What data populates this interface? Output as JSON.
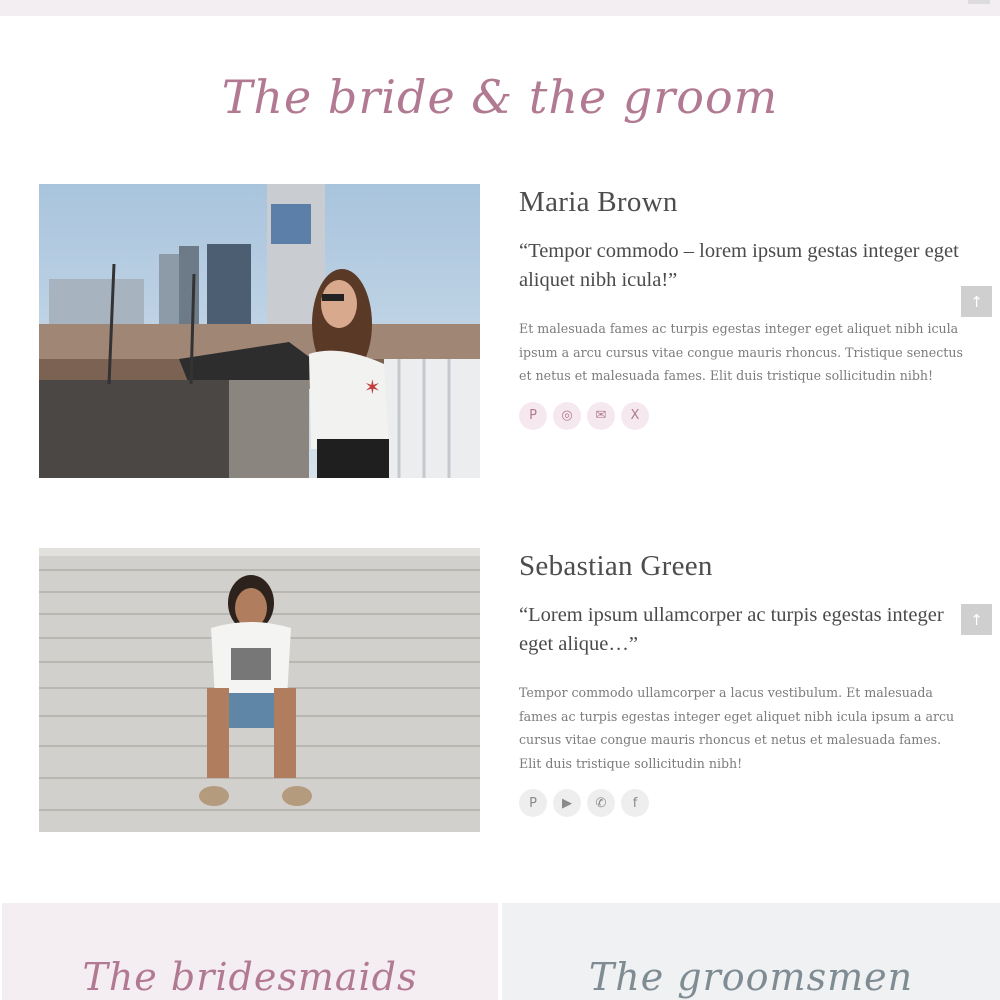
{
  "section": {
    "title": "The bride & the groom"
  },
  "bride": {
    "name": "Maria Brown",
    "quote": "“Tempor commodo – lorem ipsum gestas integer eget aliquet nibh icula!”",
    "description": "Et malesuada fames ac turpis egestas integer eget aliquet nibh icula ipsum a arcu cursus vitae congue mauris rhoncus. Tristique senectus et netus et malesuada fames. Elit duis tristique sollicitudin nibh!",
    "socials": [
      {
        "icon": "pinterest-icon",
        "glyph": "P"
      },
      {
        "icon": "instagram-icon",
        "glyph": "◎"
      },
      {
        "icon": "email-icon",
        "glyph": "✉"
      },
      {
        "icon": "x-twitter-icon",
        "glyph": "X"
      }
    ]
  },
  "groom": {
    "name": "Sebastian Green",
    "quote": "“Lorem ipsum ullamcorper ac turpis egestas integer eget alique…”",
    "description": "Tempor commodo ullamcorper a lacus vestibulum. Et malesuada fames ac turpis egestas integer eget aliquet nibh icula ipsum a arcu cursus vitae congue mauris rhoncus et netus et malesuada fames. Elit duis tristique sollicitudin nibh!",
    "socials": [
      {
        "icon": "pinterest-icon",
        "glyph": "P"
      },
      {
        "icon": "youtube-icon",
        "glyph": "▶"
      },
      {
        "icon": "whatsapp-icon",
        "glyph": "✆"
      },
      {
        "icon": "facebook-icon",
        "glyph": "f"
      }
    ]
  },
  "panels": {
    "bridesmaids_title": "The bridesmaids",
    "groomsmen_title": "The groomsmen"
  },
  "back_to_top": {
    "glyph": "↑"
  },
  "colors": {
    "accent_pink": "#b27a92",
    "accent_grey": "#7f8c94",
    "panel_pink": "#f4eef2",
    "panel_grey": "#eff1f2"
  }
}
